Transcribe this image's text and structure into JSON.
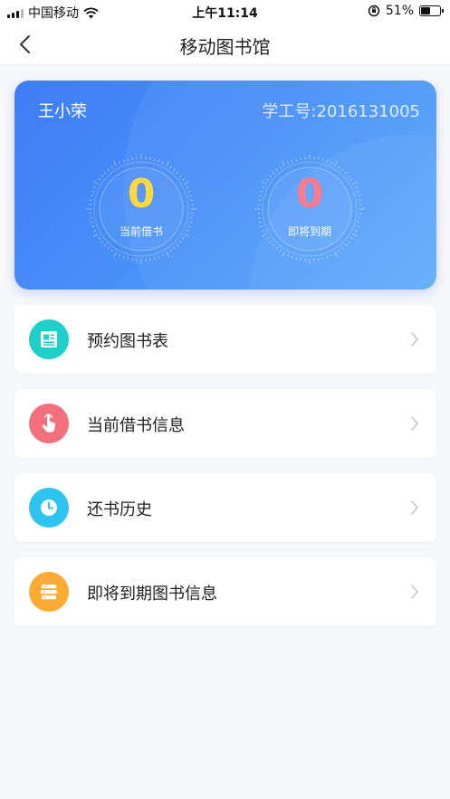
{
  "status_bar": {
    "carrier": "中国移动",
    "time": "上午11:14",
    "battery": "51%",
    "battery_level": 0.51
  },
  "nav": {
    "title": "移动图书馆"
  },
  "profile": {
    "name": "王小荣",
    "student_id": "学工号:2016131005",
    "stats": [
      {
        "value": "0",
        "label": "当前借书",
        "color": "#ffd93b"
      },
      {
        "value": "0",
        "label": "即将到期",
        "color": "#ff7a8c"
      }
    ]
  },
  "menu": [
    {
      "label": "预约图书表",
      "icon": "document-icon",
      "color": "#1fcfc9"
    },
    {
      "label": "当前借书信息",
      "icon": "hand-pointer-icon",
      "color": "#f2707b"
    },
    {
      "label": "还书历史",
      "icon": "clock-icon",
      "color": "#2ec4f2"
    },
    {
      "label": "即将到期图书信息",
      "icon": "books-icon",
      "color": "#ffaa33"
    }
  ]
}
